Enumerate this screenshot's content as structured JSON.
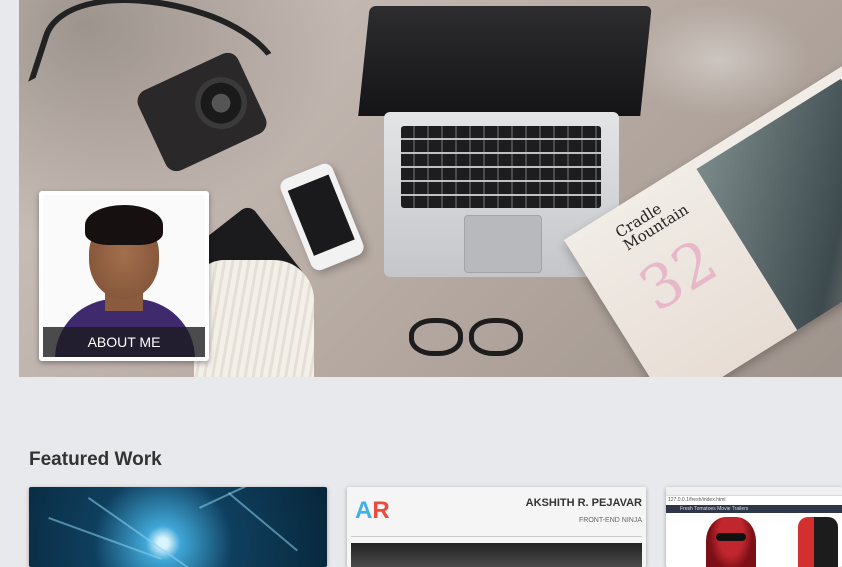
{
  "hero": {
    "about_label": "ABOUT ME",
    "magazine_title_1": "Cradle",
    "magazine_title_2": "Mountain",
    "magazine_number": "32"
  },
  "featured": {
    "title": "Featured Work",
    "cards": [
      {
        "name": "neuron-project"
      },
      {
        "name": "portfolio-site",
        "logo_a": "A",
        "logo_r": "R",
        "heading": "AKSHITH R. PEJAVAR",
        "subheading": "FRONT-END NINJA"
      },
      {
        "name": "movie-site",
        "url": "127.0.0.1/fresh/index.html",
        "banner": "Fresh Tomatoes Movie Trailers"
      }
    ]
  },
  "colors": {
    "page_background": "#e8e9ed",
    "title_text": "#333333"
  }
}
